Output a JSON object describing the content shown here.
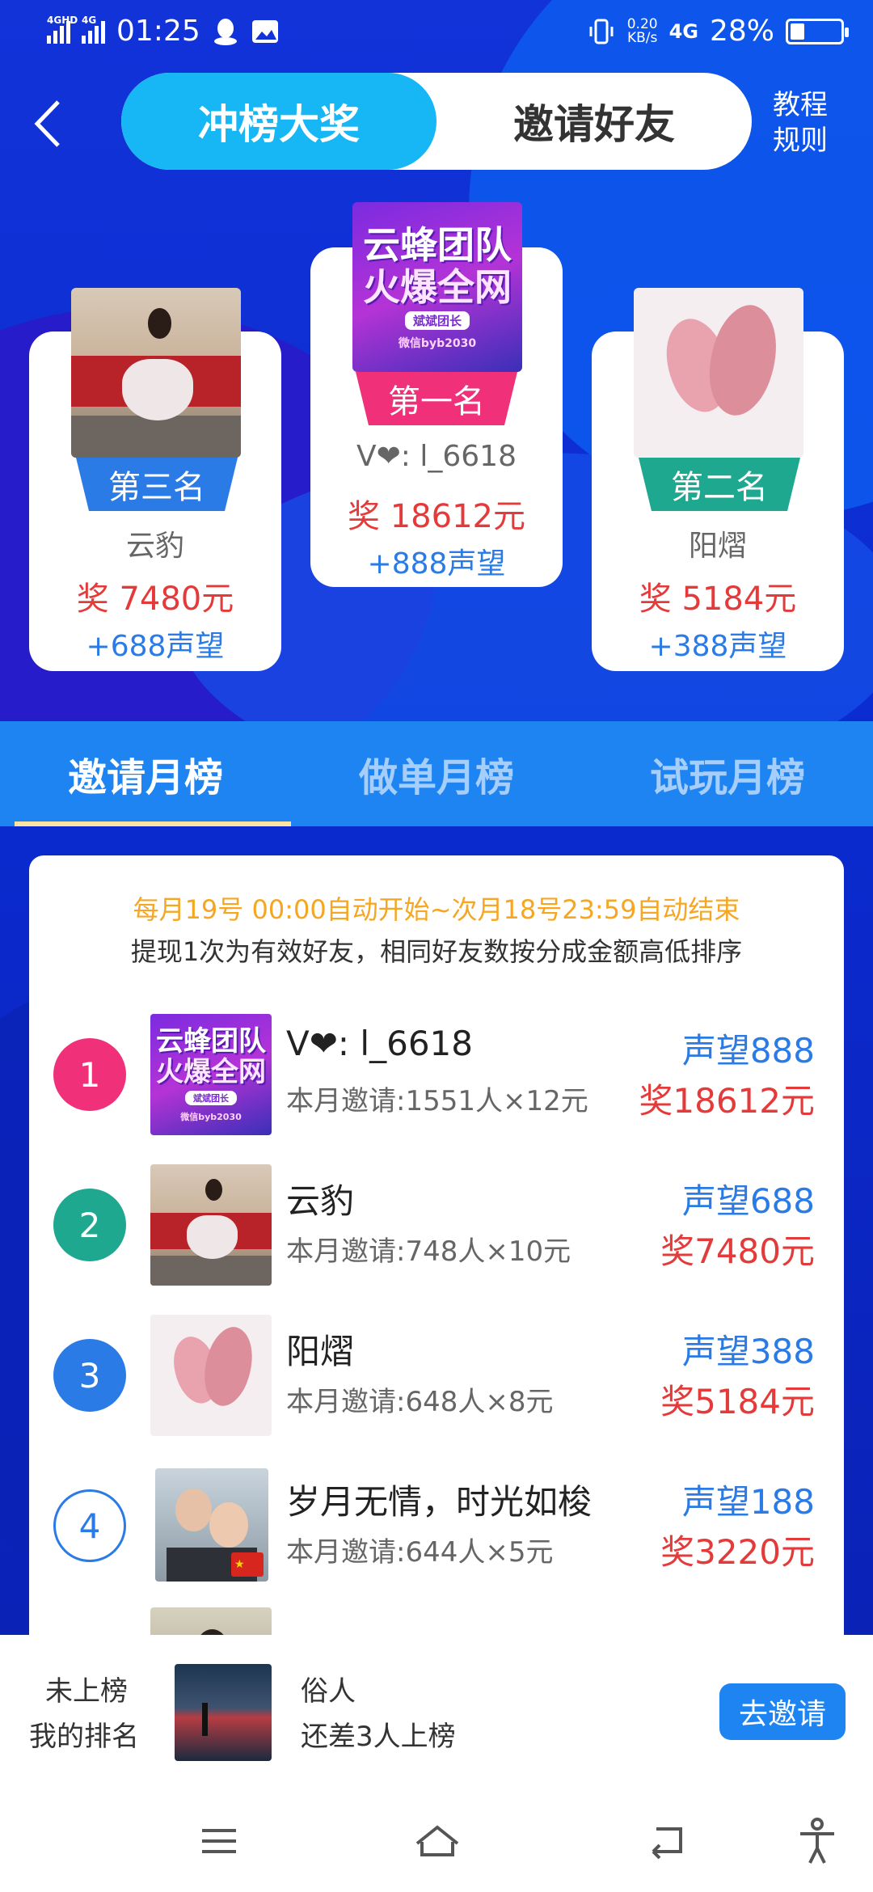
{
  "status_bar": {
    "net1": "4GHD",
    "net2": "4G",
    "time": "01:25",
    "speed_value": "0.20",
    "speed_unit": "KB/s",
    "net3": "4G",
    "battery": "28%",
    "battery_level": 0.28
  },
  "header": {
    "tab_active": "冲榜大奖",
    "tab_other": "邀请好友",
    "rules_line1": "教程",
    "rules_line2": "规则"
  },
  "podium": {
    "first": {
      "poster_l1": "云蜂团队",
      "poster_l2": "火爆全网",
      "poster_l3": "斌斌团长",
      "poster_l4": "微信byb2030",
      "rank": "第一名",
      "name": "V❤: l_6618",
      "prize": "奖 18612元",
      "fame": "+888声望"
    },
    "second": {
      "rank": "第二名",
      "name": "阳熠",
      "prize": "奖 5184元",
      "fame": "+388声望"
    },
    "third": {
      "rank": "第三名",
      "name": "云豹",
      "prize": "奖 7480元",
      "fame": "+688声望"
    }
  },
  "section_tabs": [
    "邀请月榜",
    "做单月榜",
    "试玩月榜"
  ],
  "panel": {
    "notice1": "每月19号 00:00自动开始~次月18号23:59自动结束",
    "notice2": "提现1次为有效好友，相同好友数按分成金额高低排序",
    "rows": [
      {
        "rank": "1",
        "name": "V❤: l_6618",
        "sub": "本月邀请:1551人×12元",
        "fame": "声望888",
        "prize": "奖18612元"
      },
      {
        "rank": "2",
        "name": "云豹",
        "sub": "本月邀请:748人×10元",
        "fame": "声望688",
        "prize": "奖7480元"
      },
      {
        "rank": "3",
        "name": "阳熠",
        "sub": "本月邀请:648人×8元",
        "fame": "声望388",
        "prize": "奖5184元"
      },
      {
        "rank": "4",
        "name": "岁月无情，时光如梭",
        "sub": "本月邀请:644人×5元",
        "fame": "声望188",
        "prize": "奖3220元"
      }
    ]
  },
  "my_rank": {
    "status": "未上榜",
    "label": "我的排名",
    "name": "俗人",
    "gap": "还差3人上榜",
    "button": "去邀请"
  },
  "colors": {
    "accent_blue": "#1e84f2",
    "tab_cyan": "#17b6f5",
    "prize_red": "#e53a3a",
    "fame_blue": "#2a7be6",
    "notice_orange": "#f5a623",
    "rank1": "#f0317a",
    "rank2": "#1ea88f",
    "rank3": "#2a7be6"
  }
}
